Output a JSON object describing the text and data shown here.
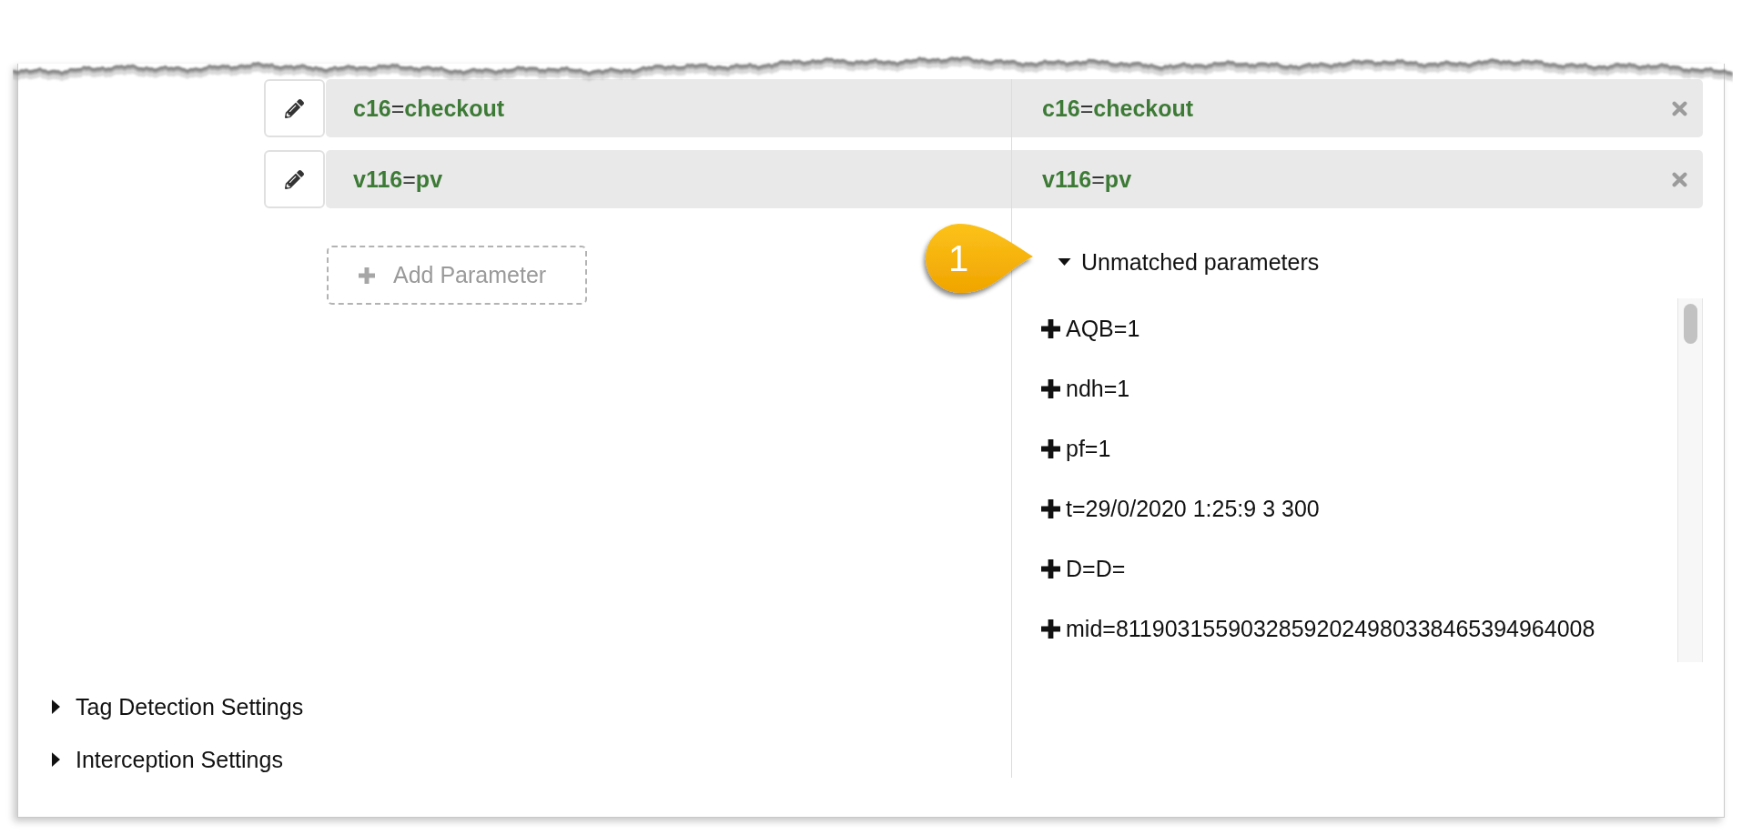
{
  "mapping_rows": [
    {
      "column_1": "**c16**=**checkout**",
      "column_2": "**c16**=**checkout**"
    },
    {
      "column_1": "**v116**=**pv**",
      "column_2": "**v116**=**pv**"
    }
  ],
  "add_button": {
    "label": "Add Parameter"
  },
  "callout": {
    "label": "1"
  },
  "unmatched": {
    "title": "Unmatched parameters",
    "expanded": true,
    "items": [
      "AQB=1",
      "ndh=1",
      "pf=1",
      "t=29/0/2020 1:25:9 3 300",
      "D=D=",
      "mid=81190315590328592024980338465394964008"
    ]
  },
  "settings_sections": [
    {
      "title": "Tag Detection Settings",
      "expanded": false
    },
    {
      "title": "Interception Settings",
      "expanded": false
    }
  ]
}
